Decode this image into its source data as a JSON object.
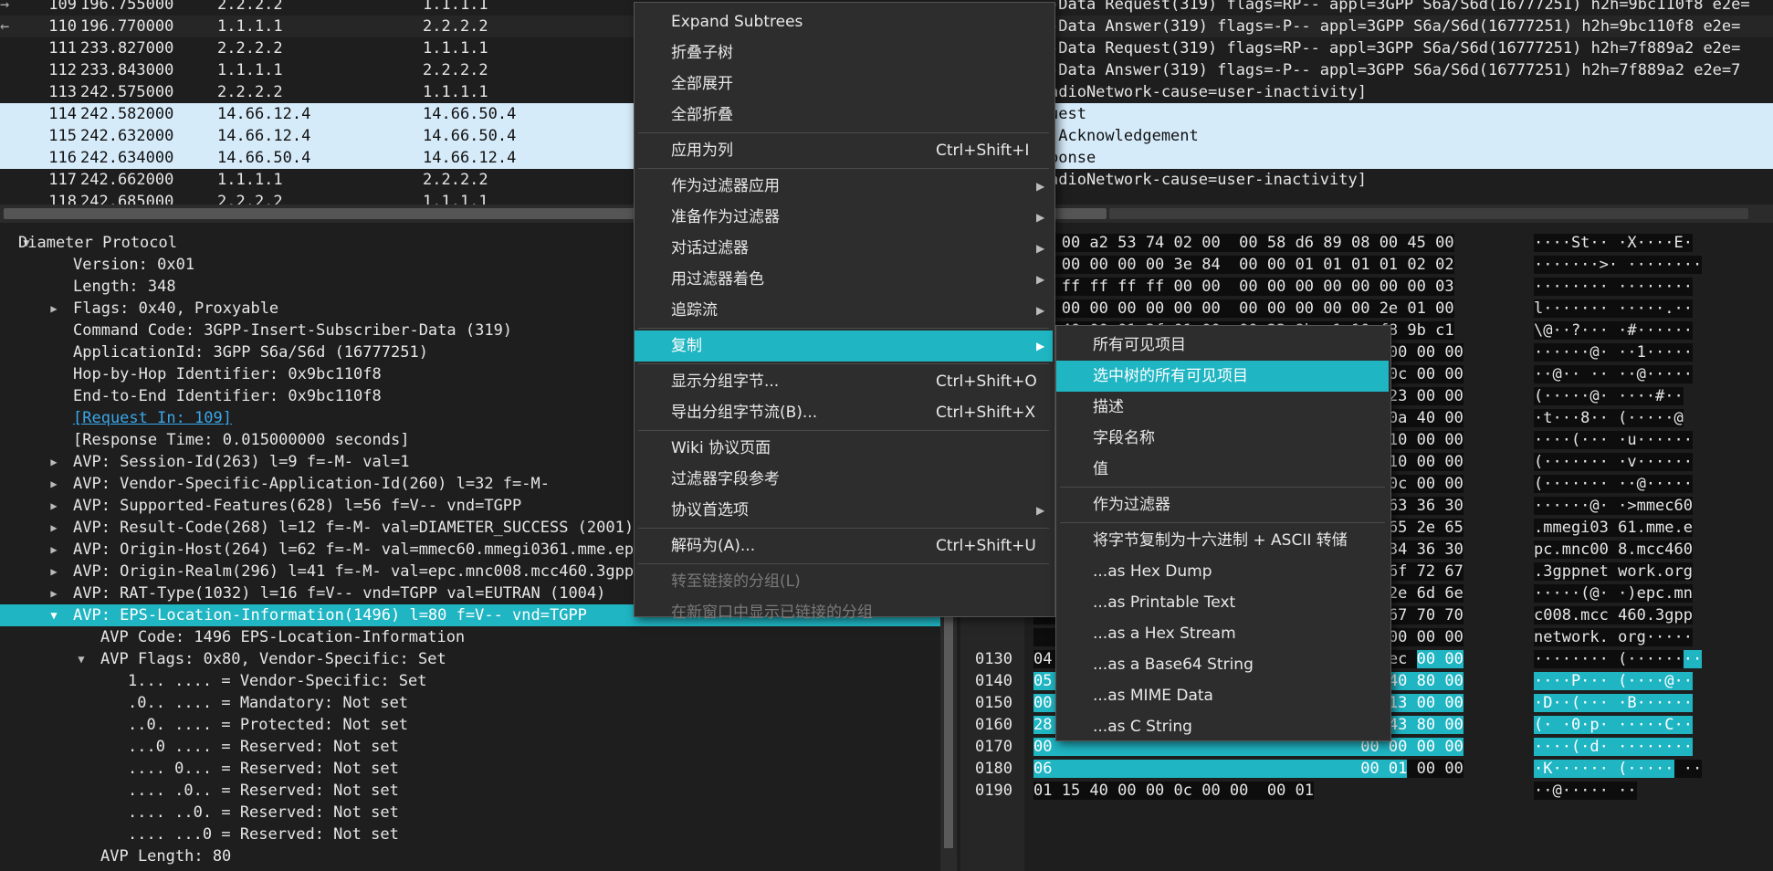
{
  "packets": [
    {
      "mark": "→",
      "no": "109",
      "time": "196.755000",
      "src": "2.2.2.2",
      "dst": "1.1.1.1",
      "info": "-Data Request(319) flags=RP-- appl=3GPP S6a/S6d(16777251) h2h=9bc110f8 e2e=",
      "state": "normal"
    },
    {
      "mark": "←",
      "no": "110",
      "time": "196.770000",
      "src": "1.1.1.1",
      "dst": "2.2.2.2",
      "info": "-Data Answer(319) flags=-P-- appl=3GPP S6a/S6d(16777251) h2h=9bc110f8 e2e=",
      "state": "alt"
    },
    {
      "mark": "",
      "no": "111",
      "time": "233.827000",
      "src": "2.2.2.2",
      "dst": "1.1.1.1",
      "info": "-Data Request(319) flags=RP-- appl=3GPP S6a/S6d(16777251) h2h=7f889a2 e2e=",
      "state": "normal"
    },
    {
      "mark": "",
      "no": "112",
      "time": "233.843000",
      "src": "1.1.1.1",
      "dst": "2.2.2.2",
      "info": "-Data Answer(319) flags=-P-- appl=3GPP S6a/S6d(16777251) h2h=7f889a2 e2e=7",
      "state": "normal"
    },
    {
      "mark": "",
      "no": "113",
      "time": "242.575000",
      "src": "2.2.2.2",
      "dst": "1.1.1.1",
      "info": "adioNetwork-cause=user-inactivity]",
      "state": "normal"
    },
    {
      "mark": "",
      "no": "114",
      "time": "242.582000",
      "src": "14.66.12.4",
      "dst": "14.66.50.4",
      "info": "uest",
      "state": "sel"
    },
    {
      "mark": "",
      "no": "115",
      "time": "242.632000",
      "src": "14.66.12.4",
      "dst": "14.66.50.4",
      "info": " Acknowledgement",
      "state": "sel"
    },
    {
      "mark": "",
      "no": "116",
      "time": "242.634000",
      "src": "14.66.50.4",
      "dst": "14.66.12.4",
      "info": "ponse",
      "state": "sel"
    },
    {
      "mark": "",
      "no": "117",
      "time": "242.662000",
      "src": "1.1.1.1",
      "dst": "2.2.2.2",
      "info": "adioNetwork-cause=user-inactivity]",
      "state": "normal"
    },
    {
      "mark": "",
      "no": "118",
      "time": "242.685000",
      "src": "2.2.2.2",
      "dst": "1.1.1.1",
      "info": "",
      "state": "normal"
    }
  ],
  "tree": [
    {
      "indent": 0,
      "arrow": "▼",
      "text": "Diameter Protocol"
    },
    {
      "indent": 1,
      "arrow": "",
      "text": "Version: 0x01"
    },
    {
      "indent": 1,
      "arrow": "",
      "text": "Length: 348"
    },
    {
      "indent": 1,
      "arrow": "▶",
      "text": "Flags: 0x40, Proxyable"
    },
    {
      "indent": 1,
      "arrow": "",
      "text": "Command Code: 3GPP-Insert-Subscriber-Data (319)"
    },
    {
      "indent": 1,
      "arrow": "",
      "text": "ApplicationId: 3GPP S6a/S6d (16777251)"
    },
    {
      "indent": 1,
      "arrow": "",
      "text": "Hop-by-Hop Identifier: 0x9bc110f8"
    },
    {
      "indent": 1,
      "arrow": "",
      "text": "End-to-End Identifier: 0x9bc110f8"
    },
    {
      "indent": 1,
      "arrow": "",
      "text": "[Request In: 109]",
      "link": true
    },
    {
      "indent": 1,
      "arrow": "",
      "text": "[Response Time: 0.015000000 seconds]"
    },
    {
      "indent": 1,
      "arrow": "▶",
      "text": "AVP: Session-Id(263) l=9 f=-M- val=1"
    },
    {
      "indent": 1,
      "arrow": "▶",
      "text": "AVP: Vendor-Specific-Application-Id(260) l=32 f=-M-"
    },
    {
      "indent": 1,
      "arrow": "▶",
      "text": "AVP: Supported-Features(628) l=56 f=V-- vnd=TGPP"
    },
    {
      "indent": 1,
      "arrow": "▶",
      "text": "AVP: Result-Code(268) l=12 f=-M- val=DIAMETER_SUCCESS (2001)"
    },
    {
      "indent": 1,
      "arrow": "▶",
      "text": "AVP: Origin-Host(264) l=62 f=-M- val=mmec60.mmegi0361.mme.ep"
    },
    {
      "indent": 1,
      "arrow": "▶",
      "text": "AVP: Origin-Realm(296) l=41 f=-M- val=epc.mnc008.mcc460.3gpp"
    },
    {
      "indent": 1,
      "arrow": "▶",
      "text": "AVP: RAT-Type(1032) l=16 f=V-- vnd=TGPP val=EUTRAN (1004)"
    },
    {
      "indent": 1,
      "arrow": "▼",
      "text": "AVP: EPS-Location-Information(1496) l=80 f=V-- vnd=TGPP",
      "hl": true
    },
    {
      "indent": 2,
      "arrow": "",
      "text": "AVP Code: 1496 EPS-Location-Information"
    },
    {
      "indent": 2,
      "arrow": "▼",
      "text": "AVP Flags: 0x80, Vendor-Specific: Set"
    },
    {
      "indent": 3,
      "arrow": "",
      "text": "1... .... = Vendor-Specific: Set"
    },
    {
      "indent": 3,
      "arrow": "",
      "text": ".0.. .... = Mandatory: Not set"
    },
    {
      "indent": 3,
      "arrow": "",
      "text": "..0. .... = Protected: Not set"
    },
    {
      "indent": 3,
      "arrow": "",
      "text": "...0 .... = Reserved: Not set"
    },
    {
      "indent": 3,
      "arrow": "",
      "text": ".... 0... = Reserved: Not set"
    },
    {
      "indent": 3,
      "arrow": "",
      "text": ".... .0.. = Reserved: Not set"
    },
    {
      "indent": 3,
      "arrow": "",
      "text": ".... ..0. = Reserved: Not set"
    },
    {
      "indent": 3,
      "arrow": "",
      "text": ".... ...0 = Reserved: Not set"
    },
    {
      "indent": 2,
      "arrow": "",
      "text": "AVP Length: 80"
    }
  ],
  "bytes": [
    {
      "off": "",
      "hex": "00 00 a2 53 74 02 00  00 58 d6 89 08 00 45 00",
      "asc": "····St·· ·X····E·",
      "hlhex": "",
      "hlasc": "",
      "hlpos": "none"
    },
    {
      "off": "",
      "hex": "8c 00 00 00 00 3e 84  00 00 01 01 01 01 02 02",
      "asc": "·······>· ········",
      "hlhex": "",
      "hlasc": "",
      "hlpos": "none"
    },
    {
      "off": "",
      "hex": "02 ff ff ff ff 00 00  00 00 00 00 00 00 00 03",
      "asc": "········ ········",
      "hlhex": "",
      "hlasc": "",
      "hlpos": "none"
    },
    {
      "off": "",
      "hex": "6c 00 00 00 00 00 00  00 00 00 00 00 2e 01 00",
      "asc": "l······· ·····.··",
      "hlhex": "",
      "hlasc": "",
      "hlpos": "none"
    },
    {
      "off": "",
      "hex": "5c 40 00 01 3f 01 00  00 23 9b c1 10 f8 9b c1",
      "asc": "\\@··?··· ·#······",
      "hlhex": "",
      "hlasc": "",
      "hlpos": "none"
    },
    {
      "off": "",
      "hex": "                                   00 00 00 00",
      "asc": "······@· ··1·····",
      "hlhex": "",
      "hlasc": "",
      "hlpos": "none"
    },
    {
      "off": "",
      "hex": "                                   00 0c 00 00",
      "asc": "··@·· ·· ··@·····",
      "hlhex": "",
      "hlasc": "",
      "hlpos": "none"
    },
    {
      "off": "",
      "hex": "                                   00 23 00 00",
      "asc": "(·····@· ····#··",
      "hlhex": "",
      "hlasc": "",
      "hlpos": "none"
    },
    {
      "off": "",
      "hex": "                                   01 0a 40 00",
      "asc": "·t···8·· (·····@",
      "hlhex": "",
      "hlasc": "",
      "hlpos": "none"
    },
    {
      "off": "",
      "hex": "                                   00 10 00 00",
      "asc": "····(··· ·u······",
      "hlhex": "",
      "hlasc": "",
      "hlpos": "none"
    },
    {
      "off": "",
      "hex": "                                   00 10 00 00",
      "asc": "(······· ·v······",
      "hlhex": "",
      "hlasc": "",
      "hlpos": "none"
    },
    {
      "off": "",
      "hex": "                                   00 0c 00 00",
      "asc": "(······· ··@·····",
      "hlhex": "",
      "hlasc": "",
      "hlpos": "none"
    },
    {
      "off": "",
      "hex": "                                   65 63 36 30",
      "asc": "······@· ·>mmec60",
      "hlhex": "",
      "hlasc": "",
      "hlpos": "none"
    },
    {
      "off": "",
      "hex": "                                   6d 65 2e 65",
      "asc": ".mmegi03 61.mme.e",
      "hlhex": "",
      "hlasc": "",
      "hlpos": "none"
    },
    {
      "off": "",
      "hex": "                                   63 34 36 30",
      "asc": "pc.mnc00 8.mcc460",
      "hlhex": "",
      "hlasc": "",
      "hlpos": "none"
    },
    {
      "off": "",
      "hex": "                                   2e 6f 72 67",
      "asc": ".3gppnet work.org",
      "hlhex": "",
      "hlasc": "",
      "hlpos": "none"
    },
    {
      "off": "",
      "hex": "                                   63 2e 6d 6e",
      "asc": "·····(@· ·)epc.mn",
      "hlhex": "",
      "hlasc": "",
      "hlpos": "none"
    },
    {
      "off": "",
      "hex": "                                   33 67 70 70",
      "asc": "c008.mcc 460.3gpp",
      "hlhex": "",
      "hlasc": "",
      "hlpos": "none"
    },
    {
      "off": "",
      "hex": "                                   00 00 00 00",
      "asc": "network. org·····",
      "hlhex": "",
      "hlasc": "",
      "hlpos": "none"
    },
    {
      "off": "0130",
      "hex": "04                                 03 ec ",
      "asc": "········ (······",
      "hlhex": "00 00",
      "hlasc": "··",
      "hlpos": "end"
    },
    {
      "off": "0140",
      "hex": "",
      "asc": "",
      "hlhex": "05                                 06 40 80 00",
      "hlasc": "····P··· (····@··",
      "hlpos": "full"
    },
    {
      "off": "0150",
      "hex": "",
      "asc": "",
      "hlhex": "00                                 00 13 00 00",
      "hlasc": "·D··(··· ·B······",
      "hlpos": "full"
    },
    {
      "off": "0160",
      "hex": "",
      "asc": "",
      "hlhex": "28                                 06 43 80 00",
      "hlasc": "(· ·0·p· ·····C··",
      "hlpos": "full"
    },
    {
      "off": "0170",
      "hex": "",
      "asc": "",
      "hlhex": "00                                 00 00 00 00",
      "hlasc": "····(·d· ········",
      "hlpos": "full"
    },
    {
      "off": "0180",
      "hex": " 00 00",
      "asc": " ··",
      "hlhex": "06                                 00 01",
      "hlasc": "·K······ (·····",
      "hlpos": "start"
    },
    {
      "off": "0190",
      "hex": "01 15 40 00 00 0c 00 00  00 01",
      "asc": "··@····· ··",
      "hlhex": "",
      "hlasc": "",
      "hlpos": "none"
    }
  ],
  "menu": [
    {
      "label": "Expand Subtrees",
      "shortcut": "",
      "sub": false,
      "state": "normal",
      "sep_after": false
    },
    {
      "label": "折叠子树",
      "shortcut": "",
      "sub": false,
      "state": "normal",
      "sep_after": false
    },
    {
      "label": "全部展开",
      "shortcut": "",
      "sub": false,
      "state": "normal",
      "sep_after": false
    },
    {
      "label": "全部折叠",
      "shortcut": "",
      "sub": false,
      "state": "normal",
      "sep_after": true
    },
    {
      "label": "应用为列",
      "shortcut": "Ctrl+Shift+I",
      "sub": false,
      "state": "normal",
      "sep_after": true
    },
    {
      "label": "作为过滤器应用",
      "shortcut": "",
      "sub": true,
      "state": "normal",
      "sep_after": false
    },
    {
      "label": "准备作为过滤器",
      "shortcut": "",
      "sub": true,
      "state": "normal",
      "sep_after": false
    },
    {
      "label": "对话过滤器",
      "shortcut": "",
      "sub": true,
      "state": "normal",
      "sep_after": false
    },
    {
      "label": "用过滤器着色",
      "shortcut": "",
      "sub": true,
      "state": "normal",
      "sep_after": false
    },
    {
      "label": "追踪流",
      "shortcut": "",
      "sub": true,
      "state": "normal",
      "sep_after": true
    },
    {
      "label": "复制",
      "shortcut": "",
      "sub": true,
      "state": "active",
      "sep_after": true
    },
    {
      "label": "显示分组字节...",
      "shortcut": "Ctrl+Shift+O",
      "sub": false,
      "state": "normal",
      "sep_after": false
    },
    {
      "label": "导出分组字节流(B)...",
      "shortcut": "Ctrl+Shift+X",
      "sub": false,
      "state": "normal",
      "sep_after": true
    },
    {
      "label": "Wiki 协议页面",
      "shortcut": "",
      "sub": false,
      "state": "normal",
      "sep_after": false
    },
    {
      "label": "过滤器字段参考",
      "shortcut": "",
      "sub": false,
      "state": "normal",
      "sep_after": false
    },
    {
      "label": "协议首选项",
      "shortcut": "",
      "sub": true,
      "state": "normal",
      "sep_after": true
    },
    {
      "label": "解码为(A)...",
      "shortcut": "Ctrl+Shift+U",
      "sub": false,
      "state": "normal",
      "sep_after": true
    },
    {
      "label": "转至链接的分组(L)",
      "shortcut": "",
      "sub": false,
      "state": "disabled",
      "sep_after": false
    },
    {
      "label": "在新窗口中显示已链接的分组",
      "shortcut": "",
      "sub": false,
      "state": "disabled",
      "sep_after": false
    }
  ],
  "submenu": [
    {
      "label": "所有可见项目",
      "state": "normal",
      "sep_after": false
    },
    {
      "label": "选中树的所有可见项目",
      "state": "active",
      "sep_after": false
    },
    {
      "label": "描述",
      "state": "normal",
      "sep_after": false
    },
    {
      "label": "字段名称",
      "state": "normal",
      "sep_after": false
    },
    {
      "label": "值",
      "state": "normal",
      "sep_after": true
    },
    {
      "label": "作为过滤器",
      "state": "normal",
      "sep_after": true
    },
    {
      "label": "将字节复制为十六进制 + ASCII 转储",
      "state": "normal",
      "sep_after": false
    },
    {
      "label": "...as Hex Dump",
      "state": "normal",
      "sep_after": false
    },
    {
      "label": "...as Printable Text",
      "state": "normal",
      "sep_after": false
    },
    {
      "label": "...as a Hex Stream",
      "state": "normal",
      "sep_after": false
    },
    {
      "label": "...as a Base64 String",
      "state": "normal",
      "sep_after": false
    },
    {
      "label": "...as MIME Data",
      "state": "normal",
      "sep_after": false
    },
    {
      "label": "...as C String",
      "state": "normal",
      "sep_after": false
    }
  ],
  "colors": {
    "accent": "#1fb5c3",
    "selection": "#d6ebfa",
    "link": "#3aa7e8"
  },
  "icons": {
    "submenu": "chevron-right-icon",
    "expanded": "triangle-down-icon",
    "collapsed": "triangle-right-icon"
  }
}
